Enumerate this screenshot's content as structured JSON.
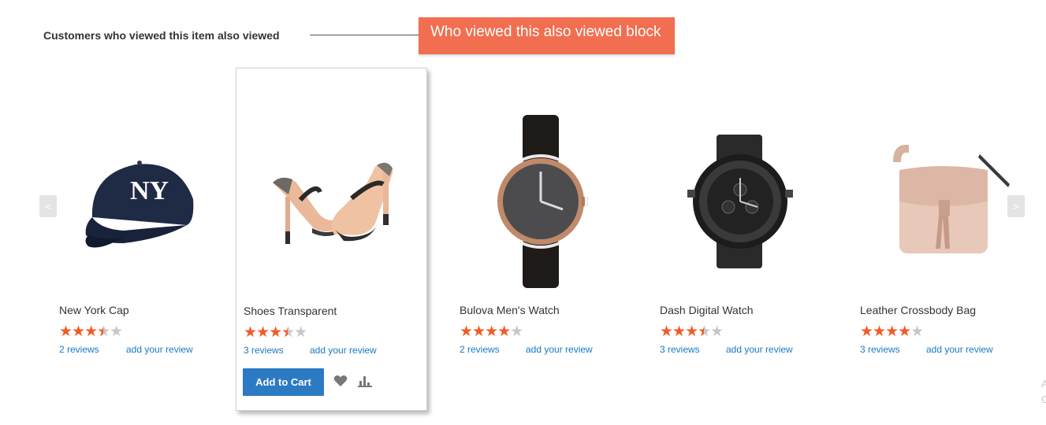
{
  "block": {
    "title": "Customers who viewed this item also viewed",
    "callout": "Who viewed this also viewed block"
  },
  "nav": {
    "prev": "<",
    "next": ">"
  },
  "products": [
    {
      "name": "New York Cap",
      "rating": 3.5,
      "reviews": "2 reviews",
      "add_review": "add your review",
      "icon": "cap-image"
    },
    {
      "name": "Shoes Transparent",
      "rating": 3.5,
      "reviews": "3 reviews",
      "add_review": "add your review",
      "icon": "heels-image",
      "add_to_cart": "Add to Cart"
    },
    {
      "name": "Bulova Men's Watch",
      "rating": 4,
      "reviews": "2 reviews",
      "add_review": "add your review",
      "icon": "watch-image"
    },
    {
      "name": "Dash Digital Watch",
      "rating": 3.5,
      "reviews": "3 reviews",
      "add_review": "add your review",
      "icon": "digital-watch-image"
    },
    {
      "name": "Leather Crossbody Bag",
      "rating": 4,
      "reviews": "3 reviews",
      "add_review": "add your review",
      "icon": "bag-image"
    }
  ],
  "colors": {
    "accent": "#f26e50",
    "star": "#f15b25",
    "link": "#1979c3",
    "button": "#2c7ac3"
  },
  "watermark": {
    "line1": "A",
    "line2": "G"
  }
}
